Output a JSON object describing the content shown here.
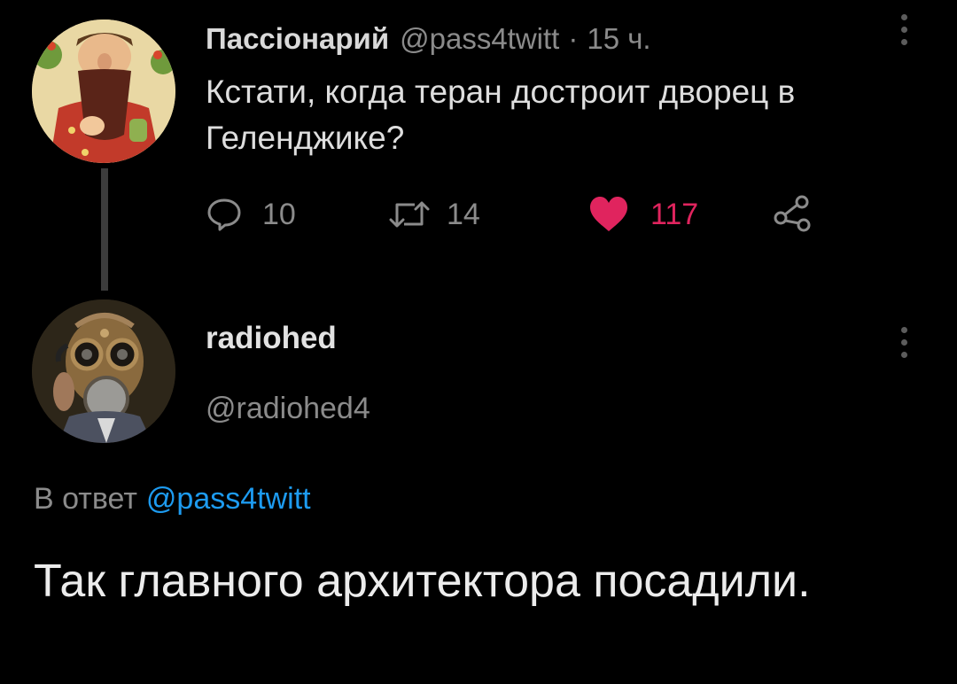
{
  "parent_tweet": {
    "author_name": "Пассіонарий",
    "handle": "@pass4twitt",
    "separator": "·",
    "time": "15 ч.",
    "text": "Кстати, когда теран достроит дворец в Геленджике?",
    "actions": {
      "replies": "10",
      "retweets": "14",
      "likes": "117",
      "liked": true
    },
    "icons": [
      "reply-icon",
      "retweet-icon",
      "heart-icon",
      "share-icon",
      "more-vertical-icon"
    ]
  },
  "reply_tweet": {
    "author_name": "radiohed",
    "handle": "@radiohed4",
    "reply_context": {
      "prefix": "В ответ",
      "mention": "@pass4twitt"
    },
    "text": "Так главного архитектора посадили."
  },
  "colors": {
    "background": "#000000",
    "primary_text": "#d9d9d9",
    "secondary_text": "#8b8b8b",
    "like": "#e0245e",
    "link": "#1d9bf0",
    "thread_line": "#3c3c3c"
  }
}
